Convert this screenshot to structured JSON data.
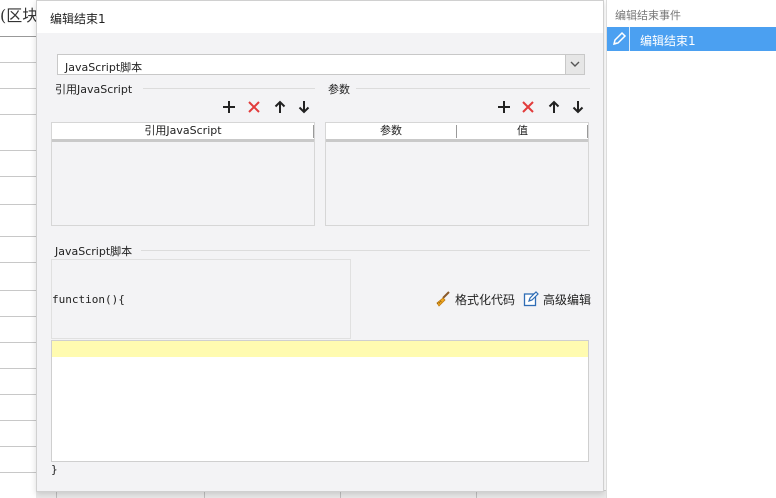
{
  "background": {
    "top_text": "(区块",
    "top_fragment_text": "……"
  },
  "dialog": {
    "title": "编辑结束1",
    "script_type_selected": "JavaScript脚本",
    "referenced": {
      "section_label": "引用JavaScript",
      "column": "引用JavaScript"
    },
    "params": {
      "section_label": "参数",
      "columns": [
        "参数",
        "值"
      ]
    },
    "script": {
      "section_label": "JavaScript脚本",
      "function_header": "function(){",
      "close_brace": "}",
      "format_button": "格式化代码",
      "advanced_button": "高级编辑"
    }
  },
  "sidebar": {
    "title": "编辑结束事件",
    "items": [
      {
        "label": "编辑结束1",
        "selected": true
      }
    ]
  },
  "colors": {
    "accent": "#4ba0f1",
    "delete_red": "#e23b3b",
    "editor_highlight": "#fffbb0"
  },
  "icons": {
    "add": "plus-icon",
    "delete": "close-icon",
    "move_up": "arrow-up-icon",
    "move_down": "arrow-down-icon",
    "format": "broom-icon",
    "advanced": "edit-document-icon",
    "sidebar_item": "pencil-icon"
  }
}
